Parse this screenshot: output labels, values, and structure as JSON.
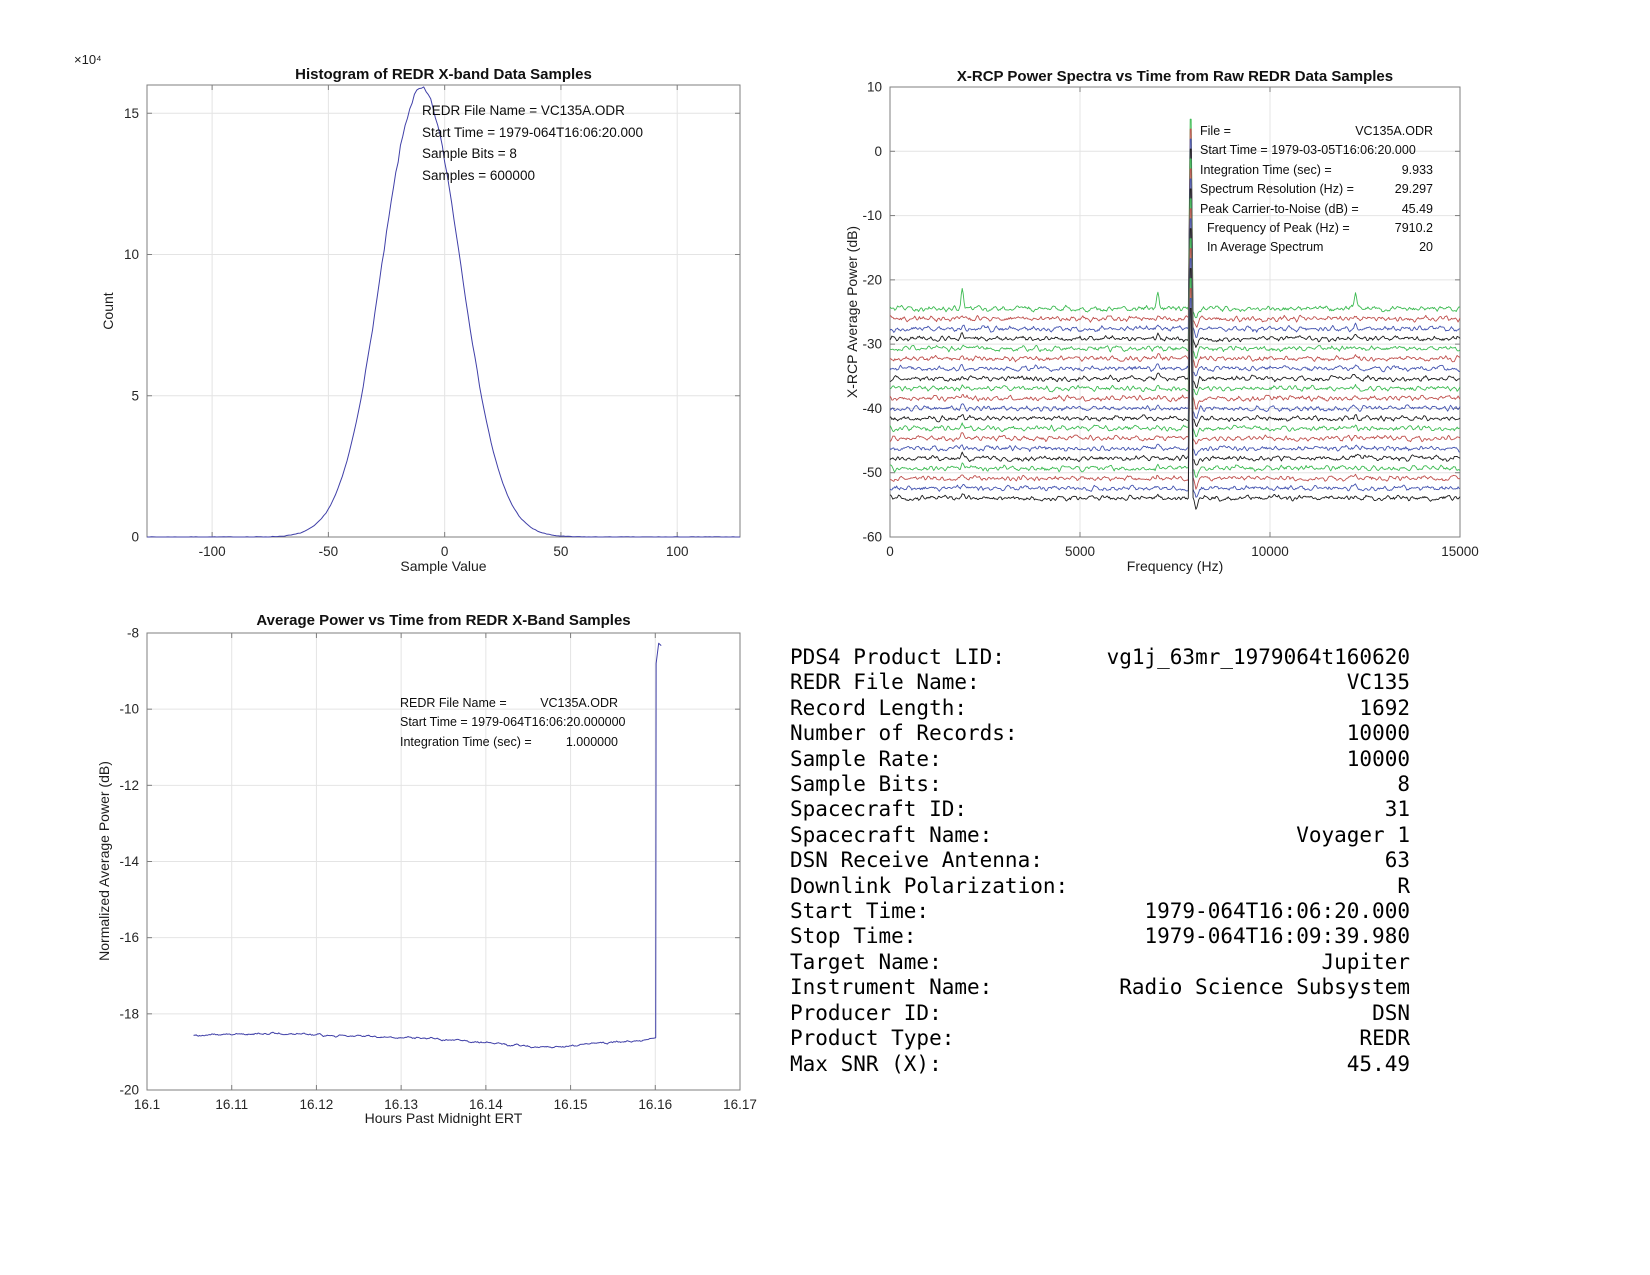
{
  "page": {
    "background": "#ffffff"
  },
  "chart_data": [
    {
      "id": "hist",
      "type": "line",
      "title": "Histogram of REDR X-band Data Samples",
      "xlabel": "Sample Value",
      "ylabel": "Count",
      "y_scale_label": "×10⁴",
      "xlim": [
        -128,
        127
      ],
      "ylim": [
        0,
        160000
      ],
      "xticks": [
        -100,
        -50,
        0,
        50,
        100
      ],
      "xtick_labels": [
        "-100",
        "-50",
        "0",
        "50",
        "100"
      ],
      "yticks": [
        0,
        50000,
        100000,
        150000
      ],
      "ytick_labels": [
        "0",
        "5",
        "10",
        "15"
      ],
      "grid": true,
      "line_color": "#4040a8",
      "gaussian": {
        "mean": -10,
        "sigma": 17,
        "peak_count": 158500
      },
      "noise_count": 900,
      "annotation_lines": [
        "REDR File Name = VC135A.ODR",
        "Start Time = 1979-064T16:06:20.000",
        "Sample Bits = 8",
        "Samples = 600000"
      ]
    },
    {
      "id": "spec",
      "type": "line",
      "title": "X-RCP Power Spectra vs Time from Raw REDR Data Samples",
      "xlabel": "Frequency (Hz)",
      "ylabel": "X-RCP Average Power (dB)",
      "xlim": [
        0,
        15000
      ],
      "ylim": [
        -60,
        10
      ],
      "xticks": [
        0,
        5000,
        10000,
        15000
      ],
      "xtick_labels": [
        "0",
        "5000",
        "10000",
        "15000"
      ],
      "yticks": [
        10,
        0,
        -10,
        -20,
        -30,
        -40,
        -50,
        -60
      ],
      "ytick_labels": [
        "10",
        "0",
        "-10",
        "-20",
        "-30",
        "-40",
        "-50",
        "-60"
      ],
      "grid": true,
      "traces": {
        "count": 20,
        "colors": [
          "#3dbb52",
          "#c0504d",
          "#4454b0",
          "#1c1c1c"
        ],
        "top_level_db": -24.5,
        "spacing_db": 1.55,
        "noise_db": 0.55,
        "carrier_hz": 7910.2,
        "carrier_top_db": 5.0,
        "minor_peaks_hz": [
          1900,
          7050,
          12250
        ],
        "minor_peak_amps_db": [
          3.0,
          2.6,
          2.4
        ],
        "post_carrier_dip_hz": 8060,
        "post_carrier_dip_db": 1.4
      },
      "annotation_rows": [
        {
          "label": "File =",
          "value": "VC135A.ODR"
        },
        {
          "label": "Start Time = 1979-03-05T16:06:20.000",
          "value": ""
        },
        {
          "label": "Integration Time (sec) =",
          "value": "9.933"
        },
        {
          "label": "Spectrum Resolution (Hz) =",
          "value": "29.297"
        },
        {
          "label": "Peak Carrier-to-Noise (dB) =",
          "value": "45.49"
        },
        {
          "label": "  Frequency of Peak (Hz) =",
          "value": "7910.2"
        },
        {
          "label": "  In Average Spectrum",
          "value": "20"
        }
      ]
    },
    {
      "id": "avg",
      "type": "line",
      "title": "Average Power vs Time from REDR X-Band Samples",
      "xlabel": "Hours Past Midnight ERT",
      "ylabel": "Normalized Average Power (dB)",
      "xlim": [
        16.1,
        16.17
      ],
      "ylim": [
        -20,
        -8
      ],
      "xticks": [
        16.1,
        16.11,
        16.12,
        16.13,
        16.14,
        16.15,
        16.16,
        16.17
      ],
      "xtick_labels": [
        "16.1",
        "16.11",
        "16.12",
        "16.13",
        "16.14",
        "16.15",
        "16.16",
        "16.17"
      ],
      "yticks": [
        -8,
        -10,
        -12,
        -14,
        -16,
        -18,
        -20
      ],
      "ytick_labels": [
        "-8",
        "-10",
        "-12",
        "-14",
        "-16",
        "-18",
        "-20"
      ],
      "grid": true,
      "series": {
        "color": "#4040a8",
        "start_hr": 16.1055,
        "end_hr": 16.16,
        "baseline_keypoints": [
          [
            16.1055,
            -18.56
          ],
          [
            16.115,
            -18.52
          ],
          [
            16.124,
            -18.58
          ],
          [
            16.132,
            -18.63
          ],
          [
            16.139,
            -18.74
          ],
          [
            16.144,
            -18.84
          ],
          [
            16.148,
            -18.87
          ],
          [
            16.152,
            -18.8
          ],
          [
            16.156,
            -18.73
          ],
          [
            16.16,
            -18.66
          ]
        ],
        "noise_db": 0.05,
        "spike": {
          "time_hr": 16.1602,
          "top_db": -8.33
        }
      },
      "annotation_rows": [
        {
          "label": "REDR File Name =",
          "value": "VC135A.ODR"
        },
        {
          "label": "Start Time = 1979-064T16:06:20.000000",
          "value": ""
        },
        {
          "label": "Integration Time (sec) =",
          "value": "1.000000"
        }
      ]
    }
  ],
  "metadata": {
    "rows": [
      {
        "label": "PDS4 Product LID:",
        "value": "vg1j_63mr_1979064t160620"
      },
      {
        "label": "REDR File Name:",
        "value": "VC135"
      },
      {
        "label": "Record Length:",
        "value": "1692"
      },
      {
        "label": "Number of Records:",
        "value": "10000"
      },
      {
        "label": "Sample Rate:",
        "value": "10000"
      },
      {
        "label": "Sample Bits:",
        "value": "8"
      },
      {
        "label": "Spacecraft ID:",
        "value": "31"
      },
      {
        "label": "Spacecraft Name:",
        "value": "Voyager 1"
      },
      {
        "label": "DSN Receive Antenna:",
        "value": "63"
      },
      {
        "label": "Downlink Polarization:",
        "value": "R"
      },
      {
        "label": "Start Time:",
        "value": "1979-064T16:06:20.000"
      },
      {
        "label": "Stop Time:",
        "value": "1979-064T16:09:39.980"
      },
      {
        "label": "Target Name:",
        "value": "Jupiter"
      },
      {
        "label": "Instrument Name:",
        "value": "Radio Science Subsystem"
      },
      {
        "label": "Producer ID:",
        "value": "DSN"
      },
      {
        "label": "Product Type:",
        "value": "REDR"
      },
      {
        "label": "Max SNR (X):",
        "value": "45.49"
      }
    ]
  }
}
